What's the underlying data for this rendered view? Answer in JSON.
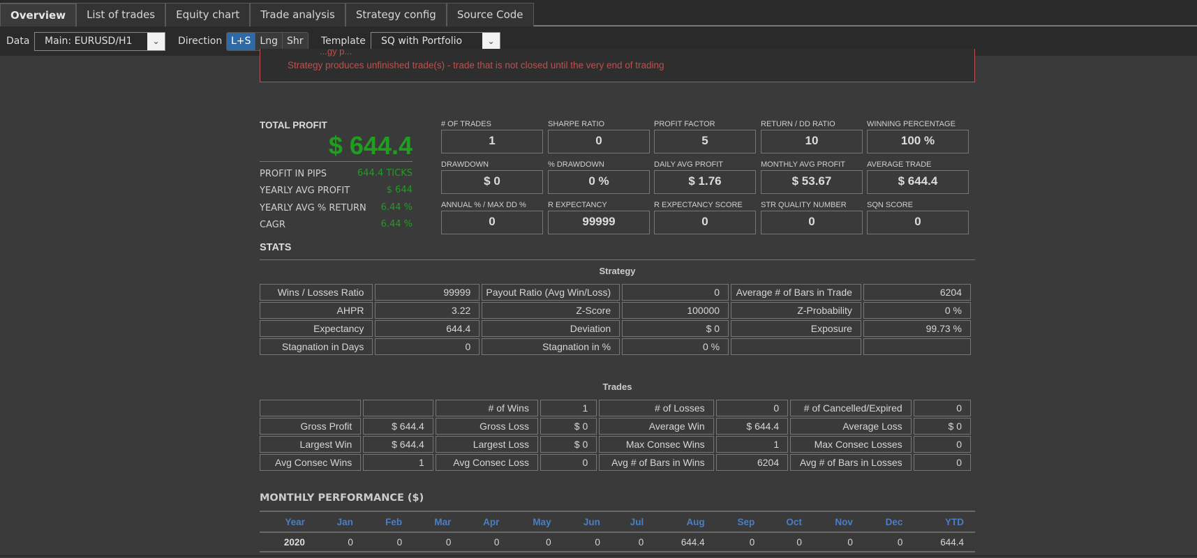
{
  "tabs": [
    {
      "label": "Overview",
      "active": true
    },
    {
      "label": "List of trades"
    },
    {
      "label": "Equity chart"
    },
    {
      "label": "Trade analysis"
    },
    {
      "label": "Strategy config"
    },
    {
      "label": "Source Code"
    }
  ],
  "toolbar": {
    "data_label": "Data",
    "data_value": "Main: EURUSD/H1",
    "direction_label": "Direction",
    "directions": [
      "L+S",
      "Lng",
      "Shr"
    ],
    "direction_active": "L+S",
    "template_label": "Template",
    "template_value": "SQ with Portfolio",
    "dropdown_icon": "chevron-down-icon"
  },
  "warning": {
    "partial_text": "...gy p...",
    "message": "Strategy produces unfinished trade(s) - trade that is not closed until the very end of trading",
    "color": "#c44d4d"
  },
  "total_profit": {
    "title": "TOTAL PROFIT",
    "value": "$ 644.4",
    "rows": [
      {
        "label": "PROFIT IN PIPS",
        "value": "644.4 TICKS"
      },
      {
        "label": "YEARLY AVG PROFIT",
        "value": "$ 644"
      },
      {
        "label": "YEARLY AVG % RETURN",
        "value": "6.44 %"
      },
      {
        "label": "CAGR",
        "value": "6.44 %"
      }
    ],
    "color": "#1f9e1f"
  },
  "kpis": [
    {
      "label": "# OF TRADES",
      "value": "1"
    },
    {
      "label": "SHARPE RATIO",
      "value": "0"
    },
    {
      "label": "PROFIT FACTOR",
      "value": "5"
    },
    {
      "label": "RETURN / DD RATIO",
      "value": "10"
    },
    {
      "label": "WINNING PERCENTAGE",
      "value": "100 %"
    },
    {
      "label": "DRAWDOWN",
      "value": "$ 0"
    },
    {
      "label": "% DRAWDOWN",
      "value": "0 %"
    },
    {
      "label": "DAILY AVG PROFIT",
      "value": "$ 1.76"
    },
    {
      "label": "MONTHLY AVG PROFIT",
      "value": "$ 53.67"
    },
    {
      "label": "AVERAGE TRADE",
      "value": "$ 644.4"
    },
    {
      "label": "ANNUAL % / MAX DD %",
      "value": "0"
    },
    {
      "label": "R EXPECTANCY",
      "value": "99999"
    },
    {
      "label": "R EXPECTANCY SCORE",
      "value": "0"
    },
    {
      "label": "STR QUALITY NUMBER",
      "value": "0"
    },
    {
      "label": "SQN SCORE",
      "value": "0"
    }
  ],
  "stats": {
    "title": "STATS",
    "strategy_title": "Strategy",
    "strategy_rows": [
      [
        "Wins / Losses Ratio",
        "99999",
        "Payout Ratio (Avg Win/Loss)",
        "0",
        "Average # of Bars in Trade",
        "6204"
      ],
      [
        "AHPR",
        "3.22",
        "Z-Score",
        "100000",
        "Z-Probability",
        "0 %"
      ],
      [
        "Expectancy",
        "644.4",
        "Deviation",
        "$ 0",
        "Exposure",
        "99.73 %"
      ],
      [
        "Stagnation in Days",
        "0",
        "Stagnation in %",
        "0 %",
        "",
        ""
      ]
    ],
    "trades_title": "Trades",
    "trades_rows": [
      [
        "",
        "",
        "# of Wins",
        "1",
        "# of Losses",
        "0",
        "# of Cancelled/Expired",
        "0"
      ],
      [
        "Gross Profit",
        "$ 644.4",
        "Gross Loss",
        "$ 0",
        "Average Win",
        "$ 644.4",
        "Average Loss",
        "$ 0"
      ],
      [
        "Largest Win",
        "$ 644.4",
        "Largest Loss",
        "$ 0",
        "Max Consec Wins",
        "1",
        "Max Consec Losses",
        "0"
      ],
      [
        "Avg Consec Wins",
        "1",
        "Avg Consec Loss",
        "0",
        "Avg # of Bars in Wins",
        "6204",
        "Avg # of Bars in Losses",
        "0"
      ]
    ]
  },
  "monthly": {
    "title": "MONTHLY PERFORMANCE ($)",
    "headers": [
      "Year",
      "Jan",
      "Feb",
      "Mar",
      "Apr",
      "May",
      "Jun",
      "Jul",
      "Aug",
      "Sep",
      "Oct",
      "Nov",
      "Dec",
      "YTD"
    ],
    "rows": [
      [
        "2020",
        "0",
        "0",
        "0",
        "0",
        "0",
        "0",
        "0",
        "644.4",
        "0",
        "0",
        "0",
        "0",
        "644.4"
      ]
    ],
    "header_color": "#4a7fc4"
  }
}
